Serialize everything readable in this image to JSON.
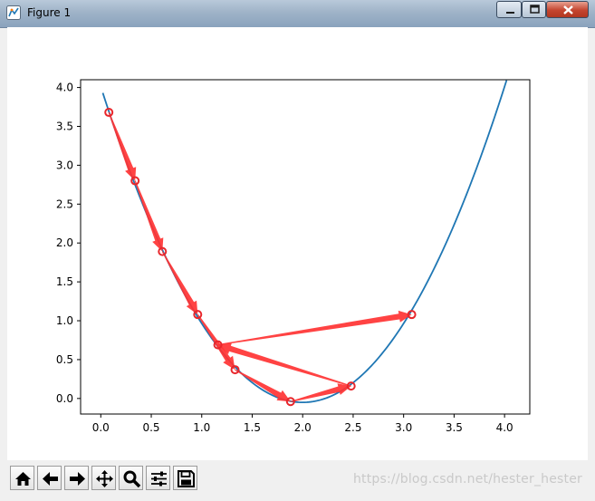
{
  "window": {
    "title": "Figure 1",
    "buttons": [
      "minimize",
      "maximize",
      "close"
    ]
  },
  "toolbar": {
    "buttons": [
      {
        "name": "home",
        "icon": "home-icon"
      },
      {
        "name": "back",
        "icon": "arrow-left-icon"
      },
      {
        "name": "forward",
        "icon": "arrow-right-icon"
      },
      {
        "name": "pan",
        "icon": "move-icon"
      },
      {
        "name": "zoom",
        "icon": "magnifier-icon"
      },
      {
        "name": "configure-subplots",
        "icon": "sliders-icon"
      },
      {
        "name": "save",
        "icon": "floppy-disk-icon"
      }
    ],
    "watermark": "https://blog.csdn.net/hester_hester"
  },
  "chart_data": {
    "type": "line",
    "title": "",
    "xlabel": "",
    "ylabel": "",
    "xlim": [
      -0.2,
      4.25
    ],
    "ylim": [
      -0.2,
      4.1
    ],
    "xticks": [
      "0.0",
      "0.5",
      "1.0",
      "1.5",
      "2.0",
      "2.5",
      "3.0",
      "3.5",
      "4.0"
    ],
    "yticks": [
      "0.0",
      "0.5",
      "1.0",
      "1.5",
      "2.0",
      "2.5",
      "3.0",
      "3.5",
      "4.0"
    ],
    "grid": false,
    "curve": {
      "color": "#1f77b4",
      "x_range": [
        0.02,
        4.02
      ],
      "vertex_x": 2.0,
      "min_y": -0.05,
      "y_at_ends": 3.93
    },
    "gradient_steps": {
      "color": "#ff3333",
      "points": [
        {
          "x": 0.08,
          "y": 3.68
        },
        {
          "x": 0.34,
          "y": 2.8
        },
        {
          "x": 0.61,
          "y": 1.89
        },
        {
          "x": 0.96,
          "y": 1.08
        },
        {
          "x": 1.33,
          "y": 0.37
        },
        {
          "x": 1.88,
          "y": -0.04
        },
        {
          "x": 2.48,
          "y": 0.16
        },
        {
          "x": 1.16,
          "y": 0.69
        },
        {
          "x": 3.08,
          "y": 1.08
        }
      ]
    }
  }
}
